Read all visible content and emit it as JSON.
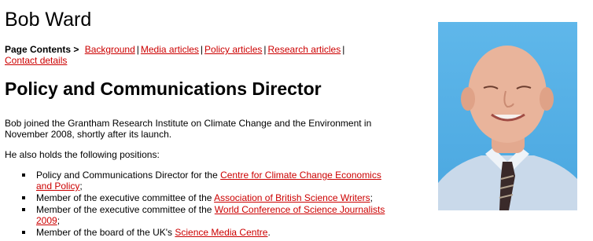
{
  "person": {
    "name": "Bob Ward"
  },
  "page_contents": {
    "label": "Page Contents >",
    "links": [
      "Background",
      "Media articles",
      "Policy articles",
      "Research articles",
      "Contact details"
    ]
  },
  "role_title": "Policy and Communications Director",
  "intro": "Bob joined the Grantham Research Institute on Climate Change and the Environment in November 2008, shortly after its launch.",
  "also_text": "He also holds the following positions:",
  "positions": [
    {
      "prefix": "Policy and Communications Director for the ",
      "link": "Centre for Climate Change Economics and Policy",
      "suffix": ";"
    },
    {
      "prefix": "Member of the executive committee of the ",
      "link": "Association of British Science Writers",
      "suffix": ";"
    },
    {
      "prefix": "Member of the executive committee of the ",
      "link": "World Conference of Science Journalists 2009",
      "suffix": ";"
    },
    {
      "prefix": "Member of the board of the UK's ",
      "link": "Science Media Centre",
      "suffix": "."
    }
  ],
  "colors": {
    "link": "#cc0000",
    "photo_background": "#5fb7ea"
  },
  "photo": {
    "subject": "portrait-photo"
  }
}
